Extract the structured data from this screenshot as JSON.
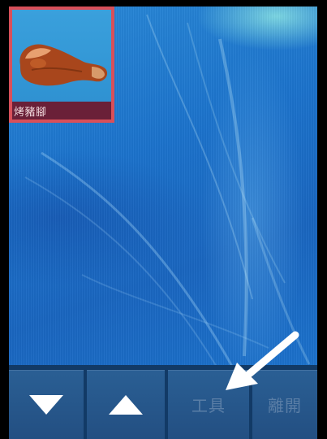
{
  "inventory": {
    "items": [
      {
        "label": "烤豬腳",
        "icon": "roast-pork-knuckle-icon",
        "selected": true
      }
    ]
  },
  "toolbar": {
    "buttons": [
      {
        "icon": "arrow-down-icon",
        "label": ""
      },
      {
        "icon": "arrow-up-icon",
        "label": ""
      },
      {
        "icon": "",
        "label": "工具"
      },
      {
        "icon": "",
        "label": "離開"
      }
    ]
  },
  "annotation": {
    "icon": "pointer-arrow-icon",
    "color": "#ffffff"
  },
  "colors": {
    "tile_border": "#d8505a",
    "label_bar": "#6a2038",
    "toolbar_bg": "#123a66",
    "button_bg": "#2a5f94",
    "button_label": "#5a7ea6",
    "wallpaper": "#1c73cc"
  }
}
